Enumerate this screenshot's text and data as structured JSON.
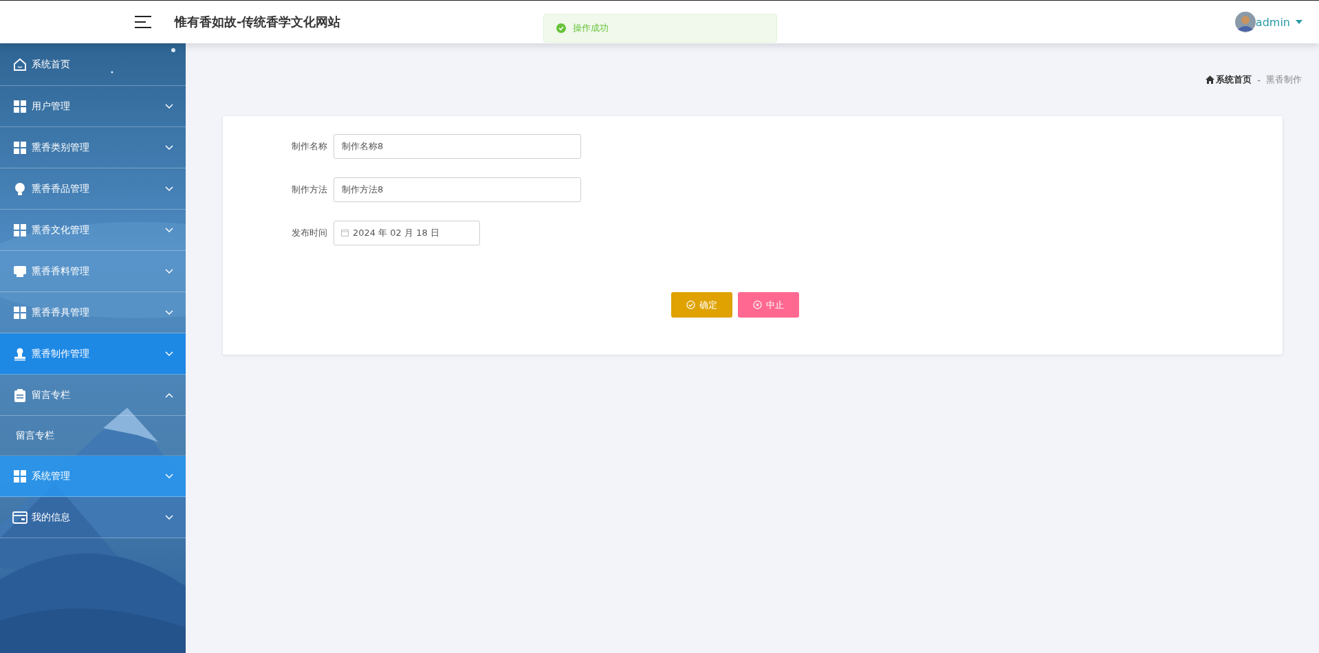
{
  "header": {
    "title": "惟有香如故-传统香学文化网站",
    "user": "admin"
  },
  "toast": {
    "kind": "success",
    "message": "操作成功"
  },
  "sidebar": {
    "items": [
      {
        "kind": "link",
        "label": "系统首页",
        "selected": false,
        "hovered": false
      },
      {
        "kind": "group",
        "label": "用户管理",
        "selected": false,
        "hovered": false,
        "expanded": false
      },
      {
        "kind": "group",
        "label": "熏香类别管理",
        "selected": false,
        "hovered": false,
        "expanded": false
      },
      {
        "kind": "group",
        "label": "熏香香品管理",
        "selected": false,
        "hovered": false,
        "expanded": false
      },
      {
        "kind": "group",
        "label": "熏香文化管理",
        "selected": false,
        "hovered": false,
        "expanded": false
      },
      {
        "kind": "group",
        "label": "熏香香料管理",
        "selected": false,
        "hovered": false,
        "expanded": false
      },
      {
        "kind": "group",
        "label": "熏香香具管理",
        "selected": false,
        "hovered": false,
        "expanded": false
      },
      {
        "kind": "group",
        "label": "熏香制作管理",
        "selected": true,
        "hovered": false,
        "expanded": false
      },
      {
        "kind": "group",
        "label": "留言专栏",
        "selected": false,
        "hovered": false,
        "expanded": true,
        "children": [
          {
            "label": "留言专栏",
            "selected": false
          }
        ]
      },
      {
        "kind": "group",
        "label": "系统管理",
        "selected": false,
        "hovered": true,
        "expanded": false
      },
      {
        "kind": "group",
        "label": "我的信息",
        "selected": false,
        "hovered": false,
        "expanded": false
      }
    ]
  },
  "breadcrumb": {
    "separator": "-",
    "items": [
      {
        "kind": "home",
        "label": "系统首页"
      },
      {
        "kind": "page",
        "label": "熏香制作"
      }
    ]
  },
  "form": {
    "fields": [
      {
        "kind": "text",
        "label": "制作名称",
        "value": "制作名称8"
      },
      {
        "kind": "text",
        "label": "制作方法",
        "value": "制作方法8"
      },
      {
        "kind": "date",
        "label": "发布时间",
        "value": "2024 年 02 月 18 日"
      }
    ],
    "buttons": [
      {
        "kind": "confirm",
        "label": "确定"
      },
      {
        "kind": "cancel",
        "label": "中止"
      }
    ]
  }
}
